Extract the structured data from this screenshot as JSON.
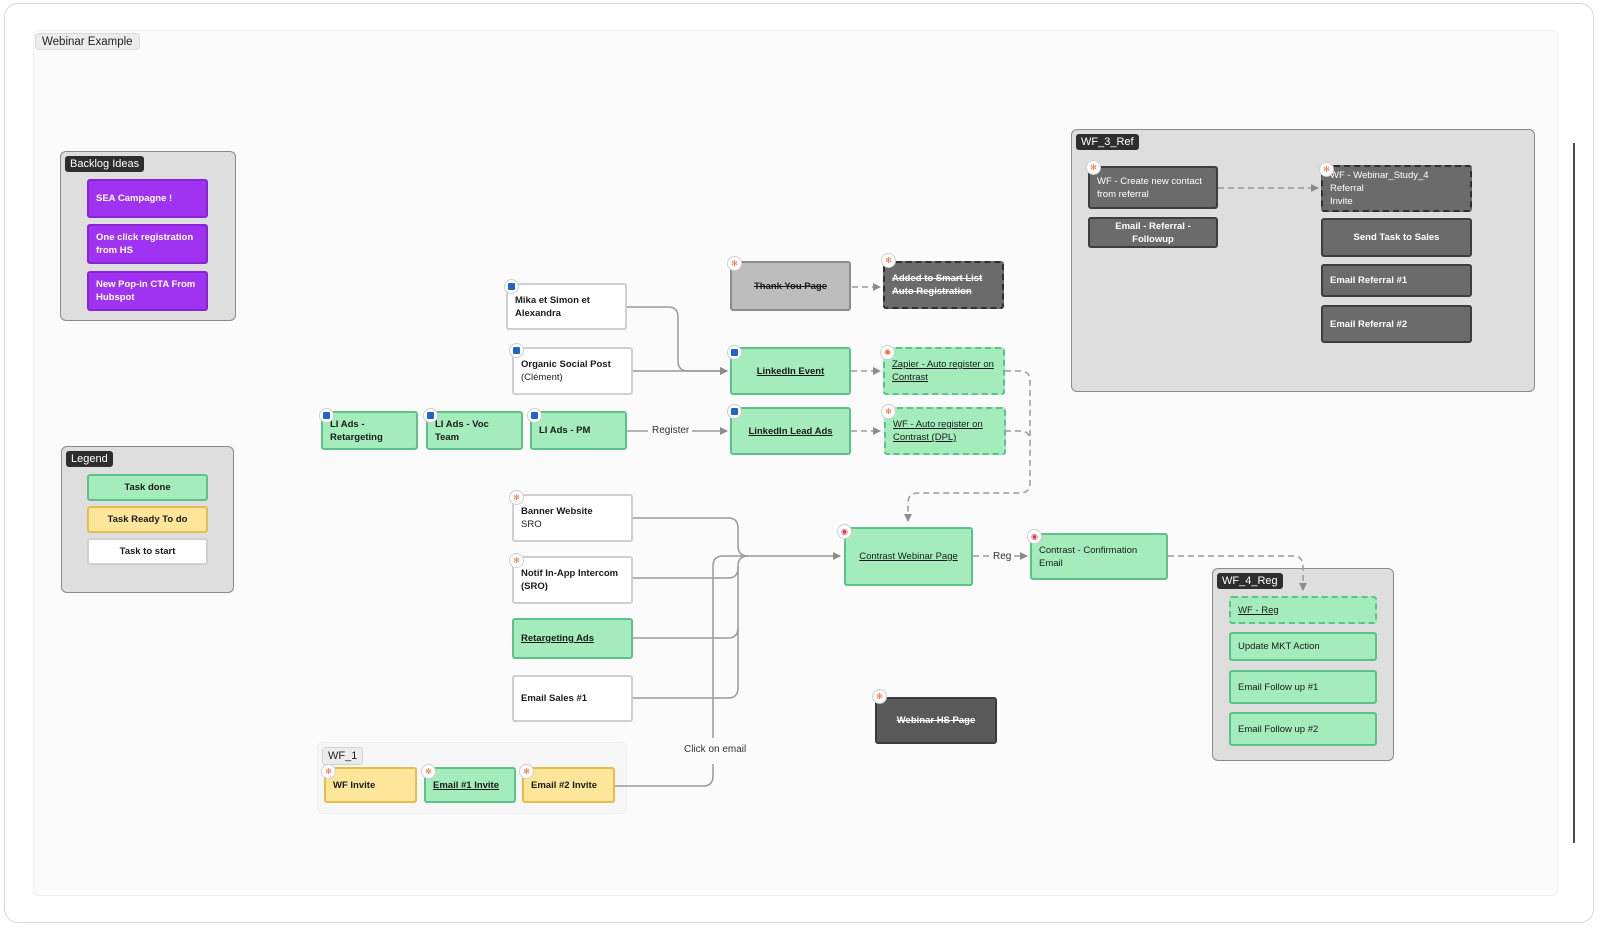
{
  "board": {
    "title": "Webinar Example"
  },
  "sections": {
    "backlog": "Backlog Ideas",
    "legend": "Legend",
    "wf3": "WF_3_Ref",
    "wf4": "WF_4_Reg",
    "wf1": "WF_1"
  },
  "backlog": [
    "SEA Campagne !",
    "One click registration from HS",
    "New Pop-in CTA From Hubspot"
  ],
  "legend": [
    "Task done",
    "Task Ready To do",
    "Task to start"
  ],
  "nodes": {
    "mika": [
      "Mika et Simon et",
      "Alexandra"
    ],
    "organic": [
      "Organic Social Post",
      "(Clément)"
    ],
    "li_retarget": [
      "LI Ads -",
      "Retargeting"
    ],
    "li_voc": "LI Ads - Voc Team",
    "li_pm": "LI Ads - PM",
    "thank_you": "Thank You Page",
    "smart_list": [
      "Added to Smart List",
      "Auto Registration"
    ],
    "li_event": "LinkedIn Event",
    "zapier": [
      "Zapier - Auto register on",
      "Contrast"
    ],
    "li_lead": "LinkedIn Lead Ads",
    "wf_auto": [
      "WF - Auto register on",
      "Contrast (DPL)"
    ],
    "banner": [
      "Banner Website",
      "SRO"
    ],
    "notif": [
      "Notif In-App Intercom",
      "(SRO)"
    ],
    "retarget_ads": "Retargeting Ads",
    "email_sales": "Email Sales #1",
    "webinar_page": "Contrast Webinar Page",
    "confirmation": [
      "Contrast - Confirmation",
      "Email"
    ],
    "webinar_hs": "Webinar HS Page",
    "wf_invite": "WF Invite",
    "email1": "Email #1 Invite",
    "email2": "Email #2 Invite",
    "wf_create": [
      "WF - Create new contact",
      "from referral"
    ],
    "email_ref_follow": "Email - Referral - Followup",
    "wf_study": [
      "WF - Webinar_Study_4 Referral",
      "Invite"
    ],
    "send_task": "Send Task to Sales",
    "email_ref1": "Email Referral #1",
    "email_ref2": "Email Referral #2",
    "wf_reg": "WF - Reg",
    "update_mkt": "Update MKT Action",
    "follow1": "Email Follow up #1",
    "follow2": "Email Follow up #2"
  },
  "edge_labels": {
    "register": "Register",
    "reg": "Reg",
    "click_email": "Click on email"
  },
  "icons": {
    "linkedin": "linkedin-icon",
    "hubspot": "hubspot-icon",
    "contrast": "contrast-icon",
    "zapier": "zapier-icon"
  },
  "colors": {
    "done": "#a4ecbc",
    "ready": "#fde69a",
    "start": "#ffffff",
    "idea": "#a033f1",
    "dark": "#6b6b6b"
  }
}
